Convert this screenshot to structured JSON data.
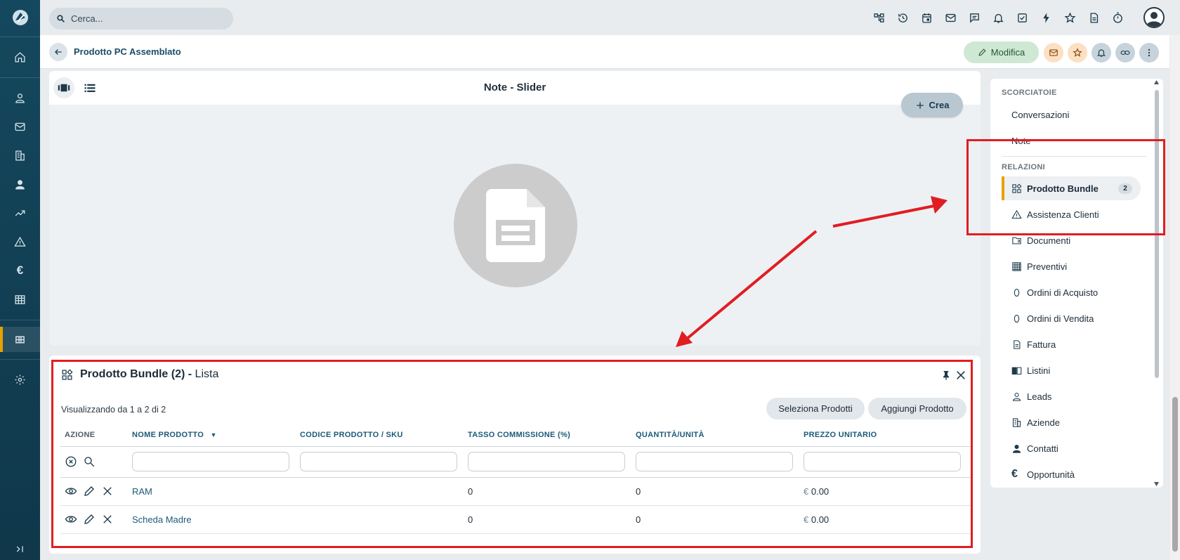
{
  "topbar": {
    "search_placeholder": "Cerca..."
  },
  "header": {
    "title": "Prodotto PC Assemblato",
    "edit_label": "Modifica"
  },
  "notes": {
    "title": "Note - Slider",
    "create_label": "Crea"
  },
  "bundle": {
    "title": "Prodotto Bundle (2)",
    "separator": "-",
    "subtitle": "Lista",
    "showing": "Visualizzando da 1 a 2 di 2",
    "select_label": "Seleziona Prodotti",
    "add_label": "Aggiungi Prodotto",
    "columns": [
      "AZIONE",
      "NOME PRODOTTO",
      "CODICE PRODOTTO / SKU",
      "TASSO COMMISSIONE (%)",
      "QUANTITÀ/UNITÀ",
      "PREZZO UNITARIO"
    ],
    "rows": [
      {
        "name": "RAM",
        "sku": "",
        "commission": "0",
        "quantity": "0",
        "currency": "€",
        "price": "0.00"
      },
      {
        "name": "Scheda Madre",
        "sku": "",
        "commission": "0",
        "quantity": "0",
        "currency": "€",
        "price": "0.00"
      }
    ]
  },
  "side": {
    "shortcuts_title": "SCORCIATOIE",
    "shortcuts": [
      "Conversazioni",
      "Note"
    ],
    "relations_title": "RELAZIONI",
    "relations": [
      {
        "label": "Prodotto Bundle",
        "badge": "2",
        "icon": "bundle-icon"
      },
      {
        "label": "Assistenza Clienti",
        "icon": "warning-icon"
      },
      {
        "label": "Documenti",
        "icon": "folder-icon"
      },
      {
        "label": "Preventivi",
        "icon": "calculator-icon"
      },
      {
        "label": "Ordini di Acquisto",
        "icon": "circle-icon"
      },
      {
        "label": "Ordini di Vendita",
        "icon": "circle-icon"
      },
      {
        "label": "Fattura",
        "icon": "document-icon"
      },
      {
        "label": "Listini",
        "icon": "book-icon"
      },
      {
        "label": "Leads",
        "icon": "person-outline-icon"
      },
      {
        "label": "Aziende",
        "icon": "building-icon"
      },
      {
        "label": "Contatti",
        "icon": "person-icon"
      },
      {
        "label": "Opportunità",
        "icon": "euro-icon"
      }
    ]
  },
  "colors": {
    "sidebar": "#14485e",
    "accent": "#e6a100",
    "annotation": "#e11d22"
  }
}
